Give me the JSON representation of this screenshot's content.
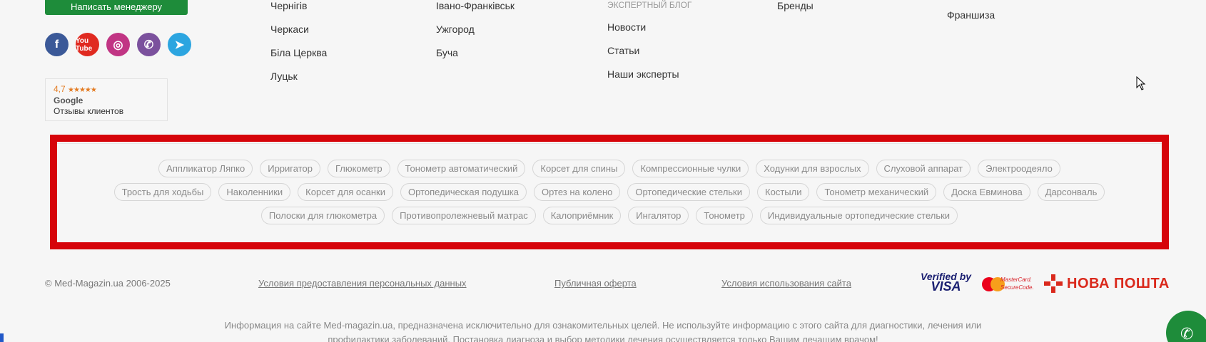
{
  "manager_button": "Написать менеджеру",
  "social": {
    "facebook": "f",
    "youtube": "You Tube",
    "instagram": "◎",
    "viber": "✆",
    "telegram": "➤"
  },
  "rating": {
    "score": "4,7",
    "stars": "★★★★★",
    "source": "Google",
    "label": "Отзывы клиентов"
  },
  "cities_col1": [
    "Чернігів",
    "Черкаси",
    "Біла Церква",
    "Луцьк"
  ],
  "cities_col2": [
    "Івано-Франківськ",
    "Ужгород",
    "Буча"
  ],
  "blog": {
    "heading": "ЭКСПЕРТНЫЙ БЛОГ",
    "items": [
      "Новости",
      "Статьи",
      "Наши эксперты"
    ]
  },
  "col4": [
    "Бренды"
  ],
  "col5": [
    "Франшиза"
  ],
  "tags": {
    "row1": [
      "Аппликатор Ляпко",
      "Ирригатор",
      "Глюкометр",
      "Тонометр автоматический",
      "Корсет для спины",
      "Компрессионные чулки",
      "Ходунки для взрослых",
      "Слуховой аппарат",
      "Электроодеяло"
    ],
    "row2": [
      "Трость для ходьбы",
      "Наколенники",
      "Корсет для осанки",
      "Ортопедическая подушка",
      "Ортез на колено",
      "Ортопедические стельки",
      "Костыли",
      "Тонометр механический",
      "Доска Евминова",
      "Дарсонваль"
    ],
    "row3": [
      "Полоски для глюкометра",
      "Противопролежневый матрас",
      "Калоприёмник",
      "Ингалятор",
      "Тонометр",
      "Индивидуальные ортопедические стельки"
    ]
  },
  "bottom": {
    "copyright": "© Med-Magazin.ua 2006-2025",
    "privacy": "Условия предоставления персональных данных",
    "offer": "Публичная оферта",
    "terms": "Условия использования сайта"
  },
  "payments": {
    "visa_line1": "Verified by",
    "visa_line2": "VISA",
    "mc_line1": "MasterCard.",
    "mc_line2": "SecureCode.",
    "nova": "НОВА ПОШТА"
  },
  "disclaimer": {
    "line1": "Информация на сайте Med-magazin.ua, предназначена исключительно для ознакомительных целей. Не используйте информацию с этого сайта для диагностики, лечения или",
    "line2": "профилактики заболеваний. Постановка диагноза и выбор методики лечения осуществляется только Вашим лечащим врачом!"
  },
  "colors": {
    "accent_green": "#1e8c3a",
    "highlight_red": "#d6040a",
    "nova_red": "#da291c"
  }
}
